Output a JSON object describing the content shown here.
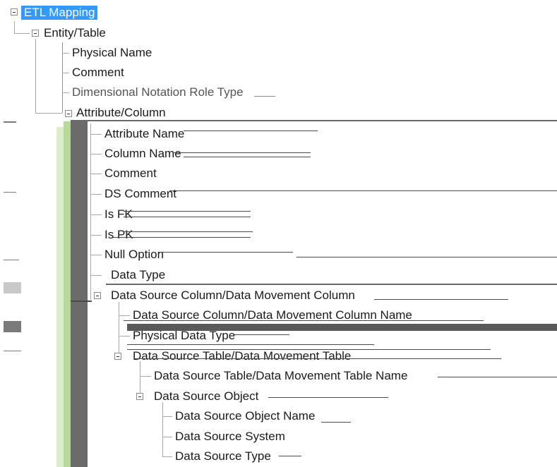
{
  "tree": {
    "root": {
      "label": "ETL Mapping",
      "selected": true
    },
    "entity": {
      "label": "Entity/Table",
      "children": [
        "Physical Name",
        "Comment",
        "Dimensional Notation Role Type"
      ]
    },
    "attribute": {
      "label": "Attribute/Column",
      "children": [
        "Attribute Name",
        "Column Name",
        "Comment",
        "DS Comment",
        "Is FK",
        "Is PK",
        "Null Option",
        "Data Type"
      ]
    },
    "ds_column": {
      "label": "Data Source Column/Data Movement Column",
      "children": [
        "Data Source Column/Data Movement Column Name",
        "Physical Data Type"
      ]
    },
    "ds_table": {
      "label": "Data Source Table/Data Movement Table",
      "children": [
        "Data Source Table/Data Movement Table Name"
      ]
    },
    "ds_object": {
      "label": "Data Source Object",
      "children": [
        "Data Source Object Name",
        "Data Source System",
        "Data Source Type"
      ]
    }
  },
  "colors": {
    "selection": "#3399ff",
    "connector": "#a8a8a8",
    "side_bar": "#6b6b6b",
    "side_accent": "#b9d99b"
  }
}
